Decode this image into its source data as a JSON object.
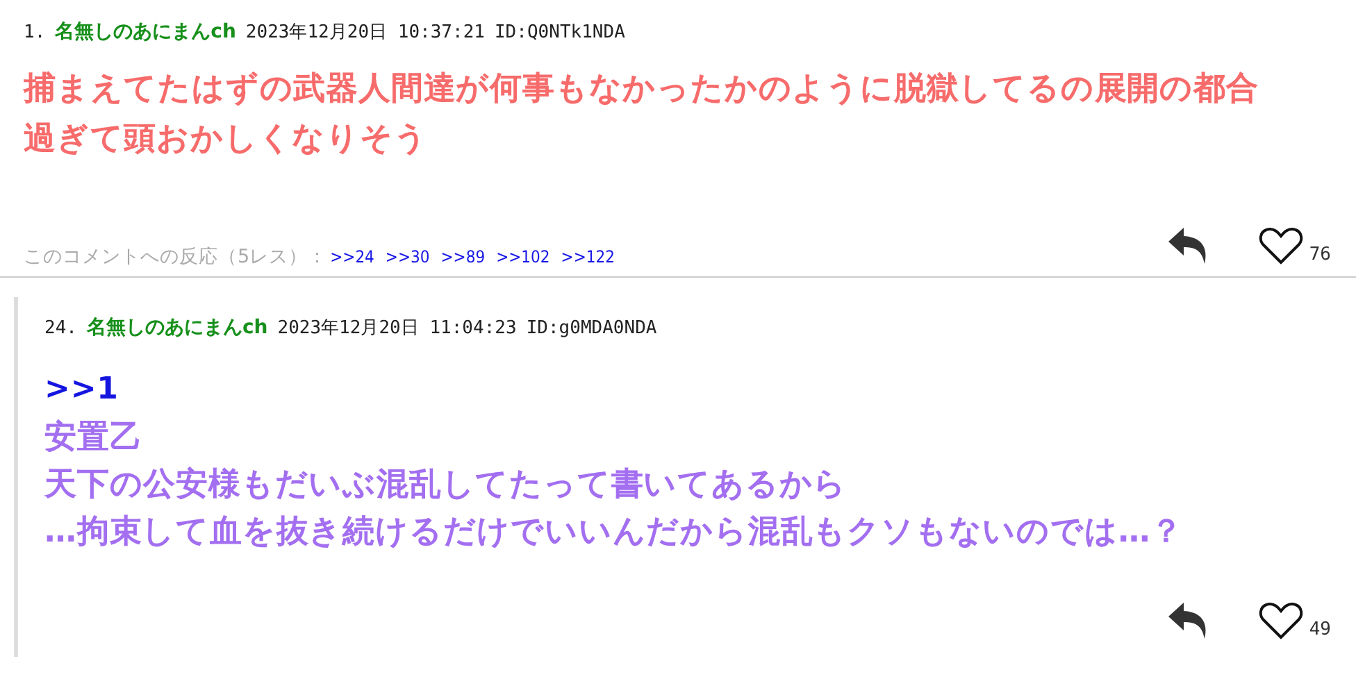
{
  "comments": [
    {
      "number": "1.",
      "name": "名無しのあにまんch",
      "date": "2023年12月20日 10:37:21",
      "id": "ID:Q0NTk1NDA",
      "nested": false,
      "color": "#f76b6b",
      "body": [
        {
          "kind": "text",
          "text": "捕まえてたはずの武器人間達が何事もなかったかのように脱獄してるの展開の都合"
        },
        {
          "kind": "text",
          "text": "過ぎて頭おかしくなりそう"
        }
      ],
      "reactions_label": "このコメントへの反応（5レス）：",
      "reactions": [
        ">>24",
        ">>30",
        ">>89",
        ">>102",
        ">>122"
      ],
      "likes": "76"
    },
    {
      "number": "24.",
      "name": "名無しのあにまんch",
      "date": "2023年12月20日 11:04:23",
      "id": "ID:g0MDA0NDA",
      "nested": true,
      "color": "#a36ff0",
      "body": [
        {
          "kind": "anchor",
          "text": ">>1"
        },
        {
          "kind": "text",
          "text": "安置乙"
        },
        {
          "kind": "text",
          "text": "天下の公安様もだいぶ混乱してたって書いてあるから"
        },
        {
          "kind": "text",
          "text": "…拘束して血を抜き続けるだけでいいんだから混乱もクソもないのでは…？"
        }
      ],
      "likes": "49"
    }
  ]
}
